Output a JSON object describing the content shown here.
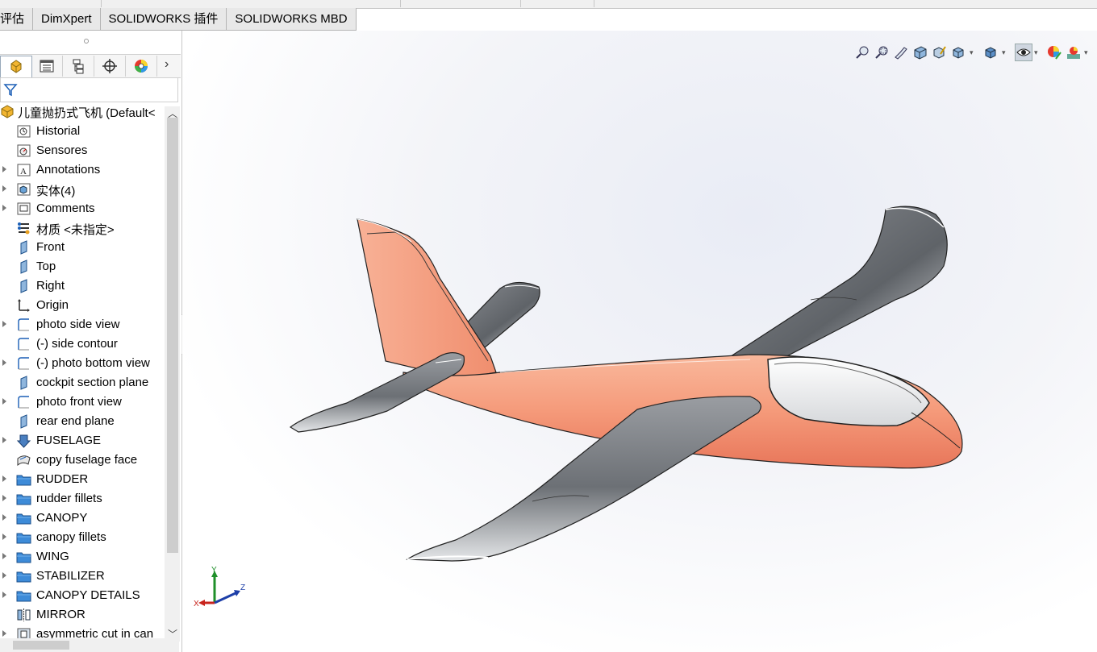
{
  "command_tabs": [
    "评估",
    "DimXpert",
    "SOLIDWORKS 插件",
    "SOLIDWORKS MBD"
  ],
  "manager_tabs": [
    "featuremanager-icon",
    "propertymanager-icon",
    "configurationmanager-icon",
    "dimxpertmanager-icon",
    "displaymanager-icon"
  ],
  "tree": {
    "root": "儿童抛扔式飞机  (Default<",
    "items": [
      {
        "label": "Historial",
        "icon": "history-icon",
        "expandable": false
      },
      {
        "label": "Sensores",
        "icon": "sensor-icon",
        "expandable": false
      },
      {
        "label": "Annotations",
        "icon": "annotations-icon",
        "expandable": true
      },
      {
        "label": "实体(4)",
        "icon": "solid-bodies-icon",
        "expandable": true
      },
      {
        "label": "Comments",
        "icon": "comments-icon",
        "expandable": true
      },
      {
        "label": "材质 <未指定>",
        "icon": "material-icon",
        "expandable": false
      },
      {
        "label": "Front",
        "icon": "plane-icon",
        "expandable": false
      },
      {
        "label": "Top",
        "icon": "plane-icon",
        "expandable": false
      },
      {
        "label": "Right",
        "icon": "plane-icon",
        "expandable": false
      },
      {
        "label": "Origin",
        "icon": "origin-icon",
        "expandable": false
      },
      {
        "label": "photo side view",
        "icon": "sketch-icon",
        "expandable": true
      },
      {
        "label": "(-) side contour",
        "icon": "sketch-icon",
        "expandable": false
      },
      {
        "label": "(-) photo bottom view",
        "icon": "sketch-icon",
        "expandable": true
      },
      {
        "label": "cockpit section plane",
        "icon": "plane-icon",
        "expandable": false
      },
      {
        "label": "photo front view",
        "icon": "sketch-icon",
        "expandable": true
      },
      {
        "label": "rear end plane",
        "icon": "plane-icon",
        "expandable": false
      },
      {
        "label": "FUSELAGE",
        "icon": "boss-extrude-icon",
        "expandable": true
      },
      {
        "label": "copy fuselage face",
        "icon": "surface-icon",
        "expandable": false
      },
      {
        "label": "RUDDER",
        "icon": "folder-icon",
        "expandable": true
      },
      {
        "label": "rudder fillets",
        "icon": "folder-icon",
        "expandable": true
      },
      {
        "label": "CANOPY",
        "icon": "folder-icon",
        "expandable": true
      },
      {
        "label": "canopy fillets",
        "icon": "folder-icon",
        "expandable": true
      },
      {
        "label": "WING",
        "icon": "folder-icon",
        "expandable": true
      },
      {
        "label": "STABILIZER",
        "icon": "folder-icon",
        "expandable": true
      },
      {
        "label": "CANOPY DETAILS",
        "icon": "folder-icon",
        "expandable": true
      },
      {
        "label": "MIRROR",
        "icon": "mirror-icon",
        "expandable": false
      },
      {
        "label": "asymmetric cut in can",
        "icon": "cut-icon",
        "expandable": true
      }
    ]
  },
  "hud_icons": [
    "zoom-to-fit-icon",
    "zoom-to-area-icon",
    "previous-view-icon",
    "section-view-icon",
    "dynamic-annotation-icon",
    "view-orientation-icon",
    "display-style-icon",
    "hide-show-items-icon",
    "edit-appearance-icon",
    "apply-scene-icon",
    "view-settings-icon"
  ],
  "triad": {
    "x": "X",
    "y": "Y",
    "z": "Z"
  },
  "colors": {
    "fuselage": "#f6a183",
    "wing": "#777a7e",
    "accent": "#0a59c9"
  }
}
